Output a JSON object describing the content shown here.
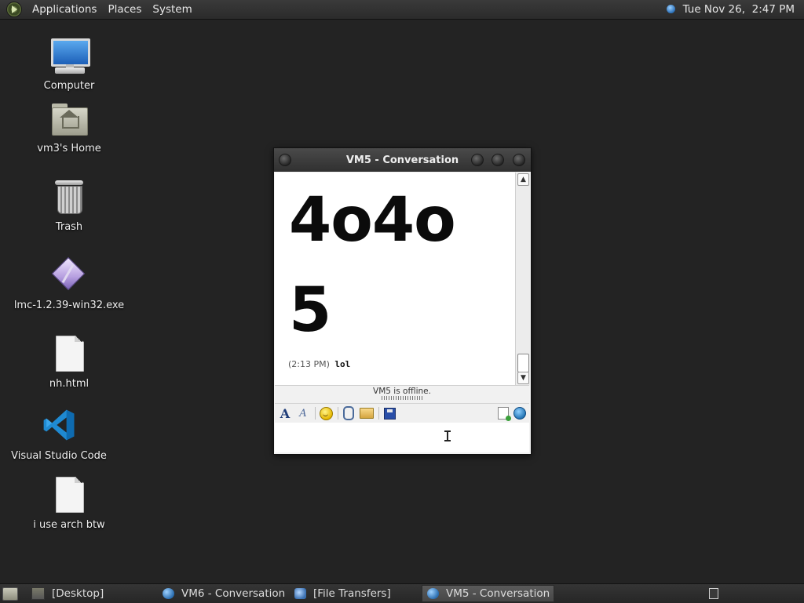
{
  "top_panel": {
    "menus": [
      "Applications",
      "Places",
      "System"
    ],
    "clock": "Tue Nov 26,  2:47 PM"
  },
  "desktop_icons": [
    {
      "label": "Computer",
      "icon": "computer-icon"
    },
    {
      "label": "vm3's Home",
      "icon": "home-folder-icon"
    },
    {
      "label": "Trash",
      "icon": "trash-icon"
    },
    {
      "label": "lmc-1.2.39-win32.exe",
      "icon": "executable-icon"
    },
    {
      "label": "nh.html",
      "icon": "file-icon"
    },
    {
      "label": "Visual Studio Code",
      "icon": "vscode-icon"
    },
    {
      "label": "i use arch btw",
      "icon": "file-icon"
    }
  ],
  "window": {
    "title": "VM5 - Conversation",
    "big_lines": [
      "4o4o",
      "5"
    ],
    "message": {
      "time": "(2:13 PM)",
      "text": "lol"
    },
    "status": "VM5 is offline.",
    "toolbar": [
      "font-icon",
      "font-style-icon",
      "smiley-icon",
      "attach-icon",
      "send-file-icon",
      "save-icon",
      "new-conversation-icon",
      "history-icon"
    ],
    "input_value": ""
  },
  "taskbar": {
    "tasks": [
      {
        "label": "[Desktop]",
        "icon": "desktop-icon",
        "active": false
      },
      {
        "label": "VM6 - Conversation",
        "icon": "chat-icon",
        "active": false
      },
      {
        "label": "[File Transfers]",
        "icon": "file-transfer-icon",
        "active": false
      },
      {
        "label": "VM5 - Conversation",
        "icon": "chat-icon",
        "active": true
      }
    ]
  },
  "colors": {
    "desktop_bg": "#232323",
    "panel_bg": "#2f2f2f",
    "window_title_bg": "#3a3a3a",
    "chat_bg": "#ffffff"
  }
}
